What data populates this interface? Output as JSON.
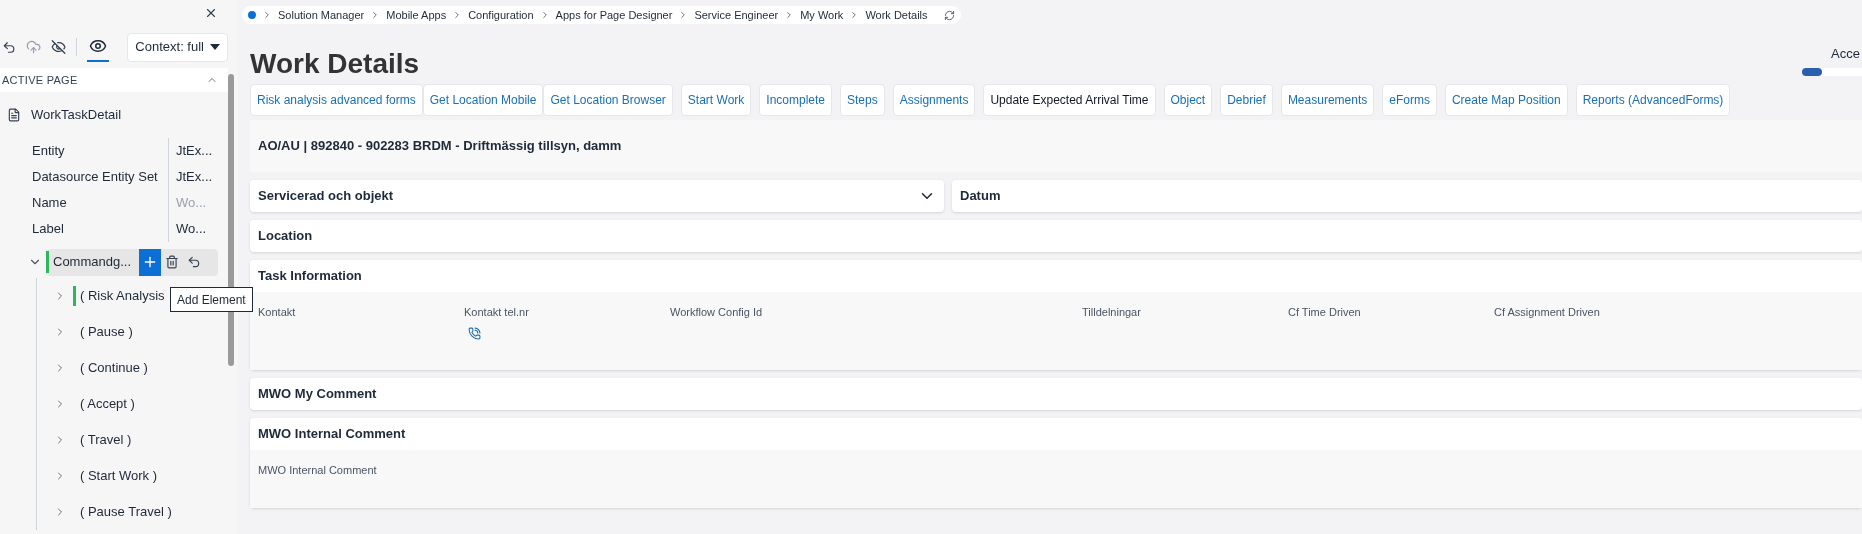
{
  "sidebar": {
    "context": "Context: full",
    "section": "ACTIVE PAGE",
    "root": {
      "label": "WorkTaskDetail"
    },
    "properties": [
      {
        "name": "Entity",
        "value": "JtEx...",
        "muted": false
      },
      {
        "name": "Datasource Entity Set",
        "value": "JtEx...",
        "muted": false
      },
      {
        "name": "Name",
        "value": "Wo...",
        "muted": true
      },
      {
        "name": "Label",
        "value": "Wo...",
        "muted": false
      }
    ],
    "tree": [
      {
        "label": "Commandg...",
        "expanded": true,
        "highlighted": true,
        "children": [
          {
            "label": "( Risk Analysis",
            "expanded": false,
            "highlighted": true
          },
          {
            "label": "( Pause )",
            "expanded": false,
            "highlighted": false
          },
          {
            "label": "( Continue )",
            "expanded": false,
            "highlighted": false
          },
          {
            "label": "( Accept )",
            "expanded": false,
            "highlighted": false
          },
          {
            "label": "( Travel )",
            "expanded": false,
            "highlighted": false
          },
          {
            "label": "( Start Work )",
            "expanded": false,
            "highlighted": false
          },
          {
            "label": "( Pause Travel )",
            "expanded": false,
            "highlighted": false
          }
        ]
      }
    ],
    "tooltip": "Add Element"
  },
  "breadcrumb": [
    "Solution Manager",
    "Mobile Apps",
    "Configuration",
    "Apps for Page Designer",
    "Service Engineer",
    "My Work",
    "Work Details"
  ],
  "title": "Work Details",
  "toggle": {
    "label": "Acce",
    "on": false
  },
  "toolbar": [
    {
      "buttons": [
        {
          "label": "Risk analysis advanced forms",
          "kind": "link"
        },
        {
          "label": "Get Location Mobile",
          "kind": "link"
        },
        {
          "label": "Get Location Browser",
          "kind": "link"
        }
      ]
    },
    {
      "buttons": [
        {
          "label": "Start Work",
          "kind": "link"
        }
      ]
    },
    {
      "buttons": [
        {
          "label": "Incomplete",
          "kind": "link"
        }
      ]
    },
    {
      "buttons": [
        {
          "label": "Steps",
          "kind": "link"
        }
      ]
    },
    {
      "buttons": [
        {
          "label": "Assignments",
          "kind": "link"
        }
      ]
    },
    {
      "buttons": [
        {
          "label": "Update Expected Arrival Time",
          "kind": "plain"
        }
      ]
    },
    {
      "buttons": [
        {
          "label": "Object",
          "kind": "link"
        }
      ]
    },
    {
      "buttons": [
        {
          "label": "Debrief",
          "kind": "link"
        }
      ]
    },
    {
      "buttons": [
        {
          "label": "Measurements",
          "kind": "link"
        }
      ]
    },
    {
      "buttons": [
        {
          "label": "eForms",
          "kind": "link"
        }
      ]
    },
    {
      "buttons": [
        {
          "label": "Create Map Position",
          "kind": "link"
        }
      ]
    },
    {
      "buttons": [
        {
          "label": "Reports (AdvancedForms)",
          "kind": "link"
        }
      ]
    }
  ],
  "header": "AO/AU | 892840 - 902283 BRDM - Driftmässig tillsyn, damm",
  "groups": [
    {
      "title": "Servicerad och objekt",
      "expanded": false
    },
    {
      "title": "Datum"
    }
  ],
  "sections": [
    {
      "title": "Location"
    },
    {
      "title": "Task Information",
      "fields": [
        {
          "label": "Kontakt",
          "kind": "text"
        },
        {
          "label": "Kontakt tel.nr",
          "kind": "phone"
        },
        {
          "label": "Workflow Config Id",
          "kind": "wide"
        },
        {
          "label": "Tilldelningar",
          "kind": "text"
        },
        {
          "label": "Cf Time Driven",
          "kind": "text"
        },
        {
          "label": "Cf Assignment Driven",
          "kind": "text"
        }
      ]
    },
    {
      "title": "MWO My Comment"
    },
    {
      "title": "MWO Internal Comment",
      "fields": [
        {
          "label": "MWO Internal Comment",
          "kind": "text"
        }
      ]
    }
  ]
}
